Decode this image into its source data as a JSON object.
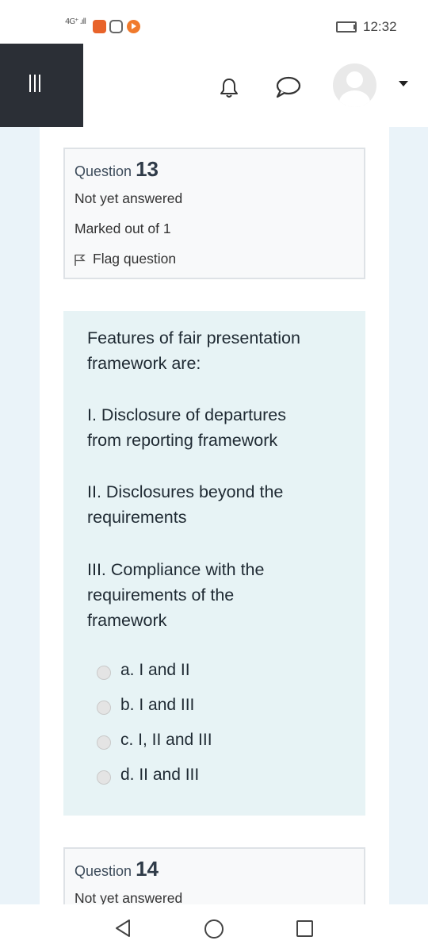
{
  "status_bar": {
    "network": "4G⁺ .ıll",
    "time": "12:32"
  },
  "nav": {
    "menu_icon": "hamburger-icon",
    "notifications_icon": "bell-icon",
    "messages_icon": "chat-icon",
    "user_icon": "avatar"
  },
  "question13": {
    "prefix": "Question",
    "number": "13",
    "status": "Not yet answered",
    "marks": "Marked out of 1",
    "flag_label": "Flag question"
  },
  "question_text": {
    "stem_line1": "Features of fair presentation",
    "stem_line2": "framework are:",
    "item1_line1": "I. Disclosure of departures",
    "item1_line2": "from reporting framework",
    "item2_line1": "II. Disclosures beyond the",
    "item2_line2": "requirements",
    "item3_line1": "III. Compliance with the",
    "item3_line2": "requirements of the",
    "item3_line3": "framework"
  },
  "answers": [
    {
      "label": "a. I and II",
      "selected": false
    },
    {
      "label": "b. I and III",
      "selected": false
    },
    {
      "label": "c. I, II and III",
      "selected": false
    },
    {
      "label": "d. II and III",
      "selected": false
    }
  ],
  "question14": {
    "prefix": "Question",
    "number": "14",
    "status": "Not yet answered"
  },
  "colors": {
    "drawer": "#2b2f36",
    "info_bg": "#f8f9fa",
    "content_bg": "#e7f3f5",
    "page_bg": "#eaf3f9"
  }
}
